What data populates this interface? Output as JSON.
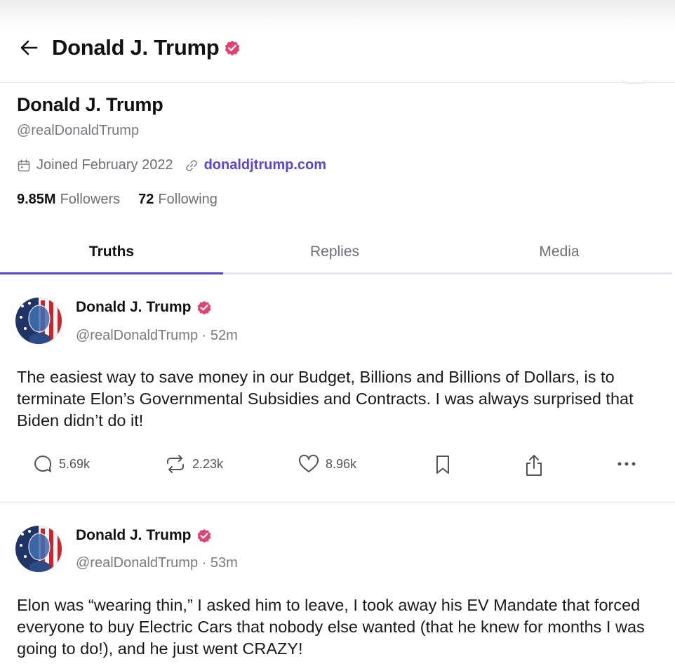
{
  "header": {
    "title": "Donald J. Trump",
    "back_icon": "arrow-left-icon",
    "verified_icon": "verified-badge-icon",
    "accent_color": "#5b45d6",
    "badge_color": "#e0436f"
  },
  "profile": {
    "name": "Donald J. Trump",
    "handle": "@realDonaldTrump",
    "joined": "Joined February 2022",
    "website": "donaldjtrump.com",
    "followers_count": "9.85M",
    "followers_label": "Followers",
    "following_count": "72",
    "following_label": "Following"
  },
  "tabs": [
    {
      "label": "Truths",
      "active": true
    },
    {
      "label": "Replies",
      "active": false
    },
    {
      "label": "Media",
      "active": false
    }
  ],
  "posts": [
    {
      "author": "Donald J. Trump",
      "meta": "@realDonaldTrump · 52m",
      "text": "The easiest way to save money in our Budget, Billions and Billions of Dollars, is to terminate Elon’s Governmental Subsidies and Contracts. I was always surprised that Biden didn’t do it!",
      "replies": "5.69k",
      "retruths": "2.23k",
      "likes": "8.96k"
    },
    {
      "author": "Donald J. Trump",
      "meta": "@realDonaldTrump · 53m",
      "text": "Elon was “wearing thin,” I asked him to leave, I took away his EV Mandate that forced everyone to buy Electric Cars that nobody else wanted (that he knew for months I was going to do!), and he just went CRAZY!"
    }
  ]
}
